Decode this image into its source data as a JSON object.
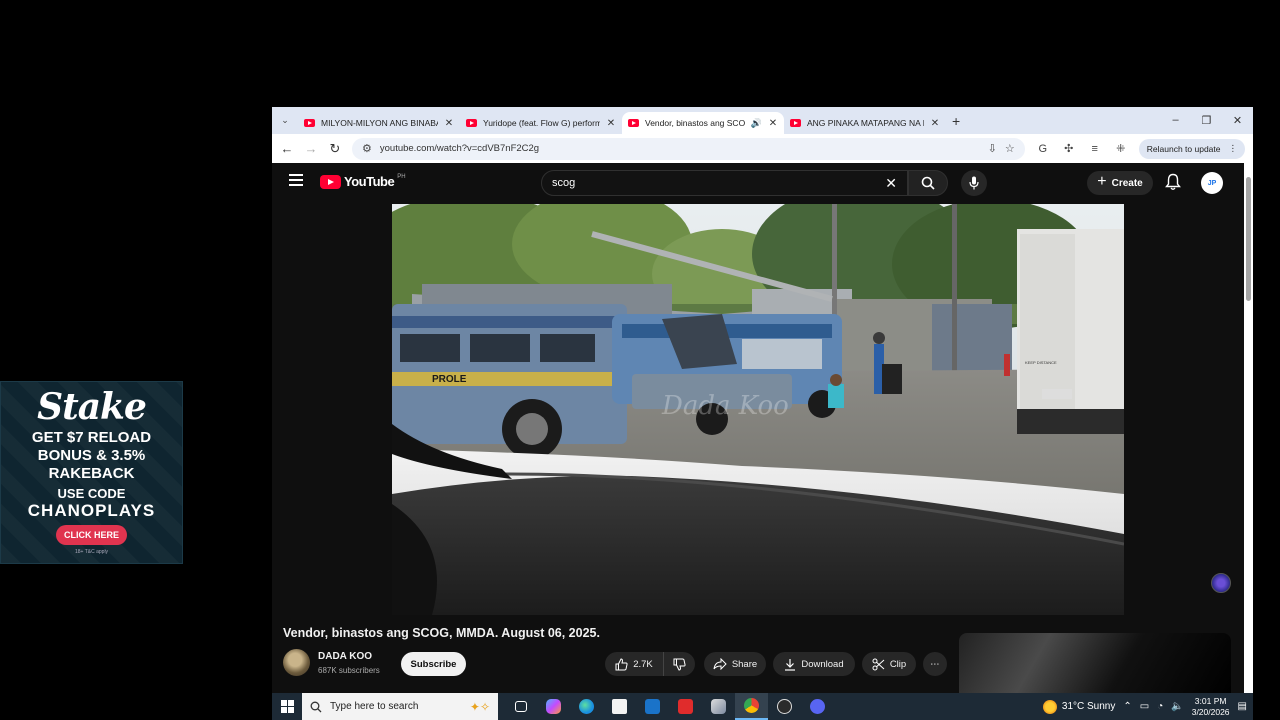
{
  "ad": {
    "brand": "Stake",
    "line1": "GET $7 RELOAD",
    "line2": "BONUS & 3.5%",
    "line3": "RAKEBACK",
    "code_label": "USE CODE",
    "code": "CHANOPLAYS",
    "cta": "CLICK HERE",
    "terms": "18+ T&C apply"
  },
  "browser": {
    "tabs": [
      {
        "title": "MILYON-MILYON ANG BINABAYAD",
        "active": false
      },
      {
        "title": "Yuridope (feat. Flow G) performa",
        "active": false
      },
      {
        "title": "Vendor, binastos ang SCOG, MM",
        "active": true
      },
      {
        "title": "ANG PINAKA MATAPANG NA BE",
        "active": false
      }
    ],
    "url": "youtube.com/watch?v=cdVB7nF2C2g",
    "relaunch_label": "Relaunch to update"
  },
  "youtube": {
    "logo_text": "YouTube",
    "country_code": "PH",
    "search_query": "scog",
    "create_label": "Create",
    "avatar_initials": "JP",
    "video_title": "Vendor, binastos ang SCOG, MMDA. August 06, 2025.",
    "channel_name": "DADA KOO",
    "subscribers": "687K subscribers",
    "subscribe_label": "Subscribe",
    "likes": "2.7K",
    "share_label": "Share",
    "download_label": "Download",
    "clip_label": "Clip",
    "watermark": "Dada Koo",
    "truck_text": "KEEP DISTANCE",
    "jeep_text": "PROLE"
  },
  "taskbar": {
    "search_placeholder": "Type here to search",
    "weather": "31°C  Sunny",
    "time": "3:01 PM",
    "date": "3/20/2026"
  },
  "colors": {
    "yt_red": "#ff0033",
    "yt_bg": "#0f0f0f",
    "chrome_tab_bg": "#dfe6f3",
    "stake_cta": "#e0344f"
  }
}
